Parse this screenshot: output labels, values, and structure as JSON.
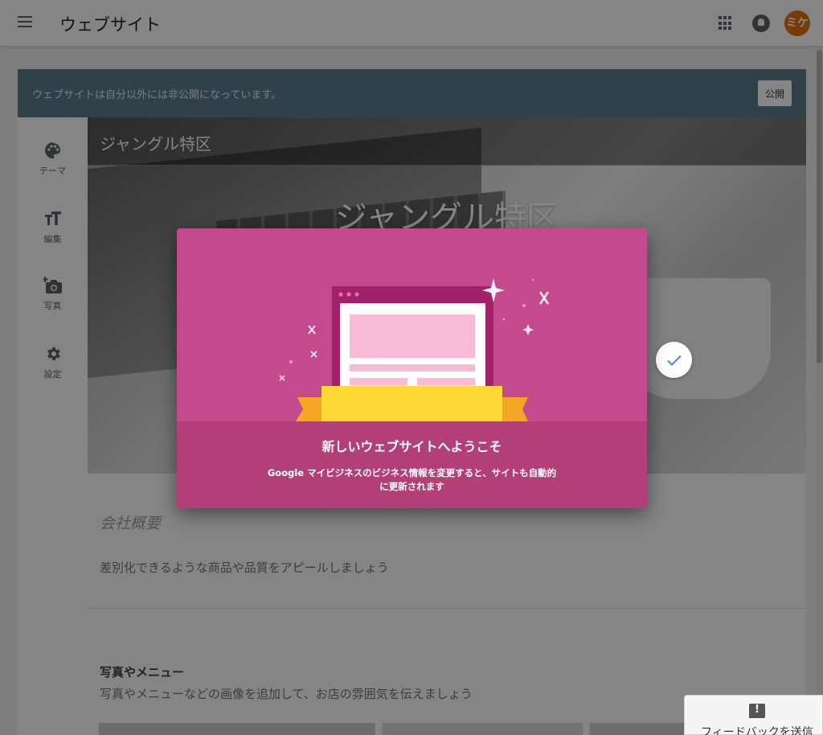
{
  "appbar": {
    "title": "ウェブサイト",
    "avatar_text": "ミケ"
  },
  "banner": {
    "message": "ウェブサイトは自分以外には非公開になっています。",
    "publish_label": "公開"
  },
  "rail": {
    "items": [
      {
        "label": "テーマ",
        "icon": "palette-icon"
      },
      {
        "label": "編集",
        "icon": "text-format-icon"
      },
      {
        "label": "写真",
        "icon": "add-photo-icon"
      },
      {
        "label": "設定",
        "icon": "gear-icon"
      }
    ]
  },
  "site": {
    "name_small": "ジャングル特区",
    "name_big": "ジャングル特区",
    "about_title": "会社概要",
    "about_desc": "差別化できるような商品や品質をアピールしましょう",
    "photos_title": "写真やメニュー",
    "photos_desc": "写真やメニューなどの画像を追加して、お店の雰囲気を伝えましょう"
  },
  "dialog": {
    "title": "新しいウェブサイトへようこそ",
    "body_line1": "Google マイビジネスのビジネス情報を変更すると、サイトも自動的",
    "body_line2": "に更新されます"
  },
  "feedback": {
    "label": "フィードバックを送信"
  },
  "colors": {
    "banner": "#5f7d8e",
    "dialog_top": "#c44a8d",
    "dialog_bottom": "#b23f78",
    "avatar": "#e8710a",
    "check": "#4285f4"
  }
}
